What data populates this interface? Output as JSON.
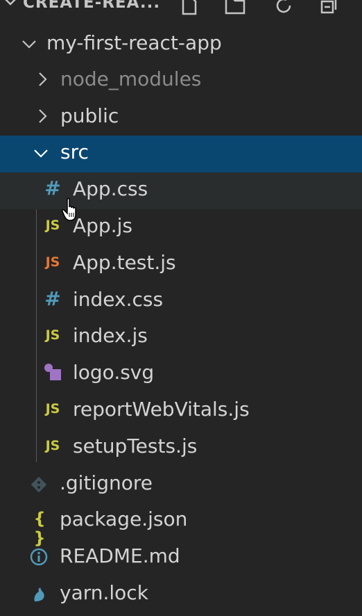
{
  "header": {
    "title": "CREATE-REA...",
    "actions": [
      "new-file-icon",
      "new-folder-icon",
      "refresh-icon",
      "collapse-all-icon"
    ]
  },
  "tree": {
    "root": {
      "name": "my-first-react-app",
      "expanded": true
    },
    "items": [
      {
        "name": "node_modules",
        "type": "folder",
        "expanded": false
      },
      {
        "name": "public",
        "type": "folder",
        "expanded": false
      },
      {
        "name": "src",
        "type": "folder",
        "expanded": true,
        "selected": true
      },
      {
        "name": "App.css",
        "type": "css",
        "icon_text": "#"
      },
      {
        "name": "App.js",
        "type": "js",
        "icon_text": "JS"
      },
      {
        "name": "App.test.js",
        "type": "test",
        "icon_text": "JS"
      },
      {
        "name": "index.css",
        "type": "css",
        "icon_text": "#"
      },
      {
        "name": "index.js",
        "type": "js",
        "icon_text": "JS"
      },
      {
        "name": "logo.svg",
        "type": "svg"
      },
      {
        "name": "reportWebVitals.js",
        "type": "js",
        "icon_text": "JS"
      },
      {
        "name": "setupTests.js",
        "type": "js",
        "icon_text": "JS"
      },
      {
        "name": ".gitignore",
        "type": "git"
      },
      {
        "name": "package.json",
        "type": "json",
        "icon_text": "{ }"
      },
      {
        "name": "README.md",
        "type": "info"
      },
      {
        "name": "yarn.lock",
        "type": "yarn"
      }
    ]
  },
  "colors": {
    "sidebar_bg": "#252526",
    "selection_bg": "#094771",
    "hover_bg": "#2a2d2e",
    "js_icon": "#cbcb41",
    "css_icon": "#519aba",
    "test_icon": "#e37933",
    "svg_icon": "#a074c4"
  }
}
